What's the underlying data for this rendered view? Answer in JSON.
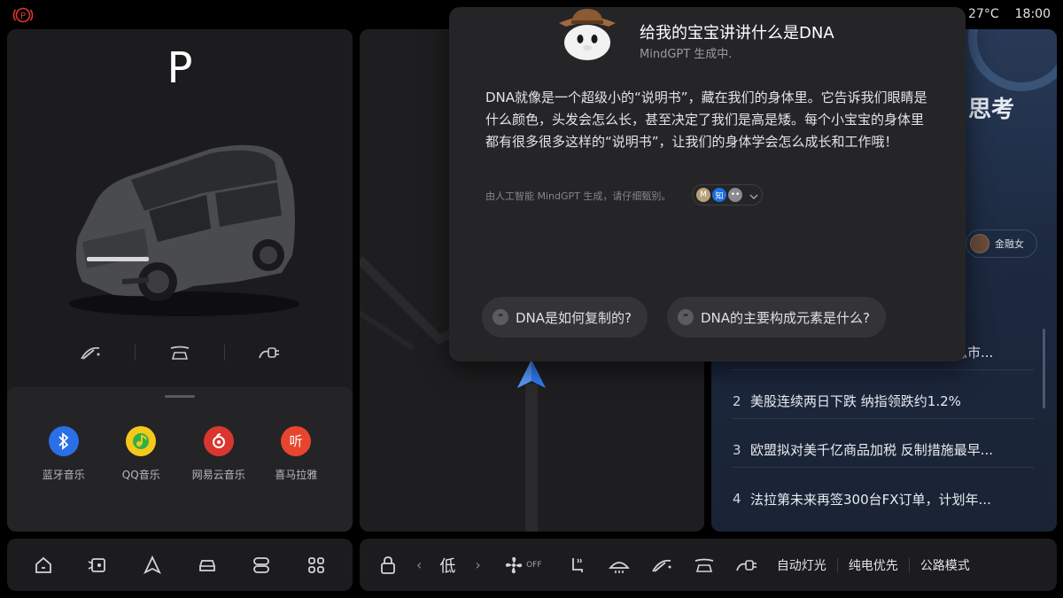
{
  "status": {
    "parking_brake_icon": "parking-brake-icon",
    "temperature": "27°C",
    "time": "18:00"
  },
  "car_panel": {
    "gear": "P",
    "controls": [
      "wiper-icon",
      "front-wash-icon",
      "charge-port-icon"
    ]
  },
  "media_apps": [
    {
      "label": "蓝牙音乐",
      "icon": "bluetooth-icon",
      "color": "#2a6ee8"
    },
    {
      "label": "QQ音乐",
      "icon": "qq-music-icon",
      "color": "#f6c81a"
    },
    {
      "label": "网易云音乐",
      "icon": "netease-music-icon",
      "color": "#d9362f"
    },
    {
      "label": "喜马拉雅",
      "icon": "ximalaya-icon",
      "color": "#e8452e"
    }
  ],
  "mindgpt": {
    "title": "给我的宝宝讲讲什么是DNA",
    "subtitle": "MindGPT 生成中.",
    "answer": "DNA就像是一个超级小的“说明书”，藏在我们的身体里。它告诉我们眼睛是什么颜色，头发会怎么长，甚至决定了我们是高是矮。每个小宝宝的身体里都有很多很多这样的“说明书”，让我们的身体学会怎么成长和工作哦！",
    "disclaimer": "由人工智能 MindGPT 生成，请仔细甄别。",
    "sources": [
      "M",
      "知",
      "••"
    ],
    "suggestions": [
      "DNA是如何复制的?",
      "DNA的主要构成元素是什么?"
    ]
  },
  "news": {
    "title_partial": "思考",
    "author": "金融女",
    "items": [
      {
        "rank": "",
        "text": "急市..."
      },
      {
        "rank": "2",
        "text": "美股连续两日下跌 纳指领跌约1.2%"
      },
      {
        "rank": "3",
        "text": "欧盟拟对美千亿商品加税 反制措施最早..."
      },
      {
        "rank": "4",
        "text": "法拉第未来再签300台FX订单，计划年..."
      }
    ]
  },
  "dock_left": [
    "home-icon",
    "media-icon",
    "navigation-icon",
    "vehicle-icon",
    "controls-icon",
    "apps-grid-icon"
  ],
  "climate_bar": {
    "fan_level": "低",
    "fan_state": "OFF",
    "auto_light": "自动灯光",
    "pure_electric": "纯电优先",
    "road_mode": "公路模式"
  }
}
